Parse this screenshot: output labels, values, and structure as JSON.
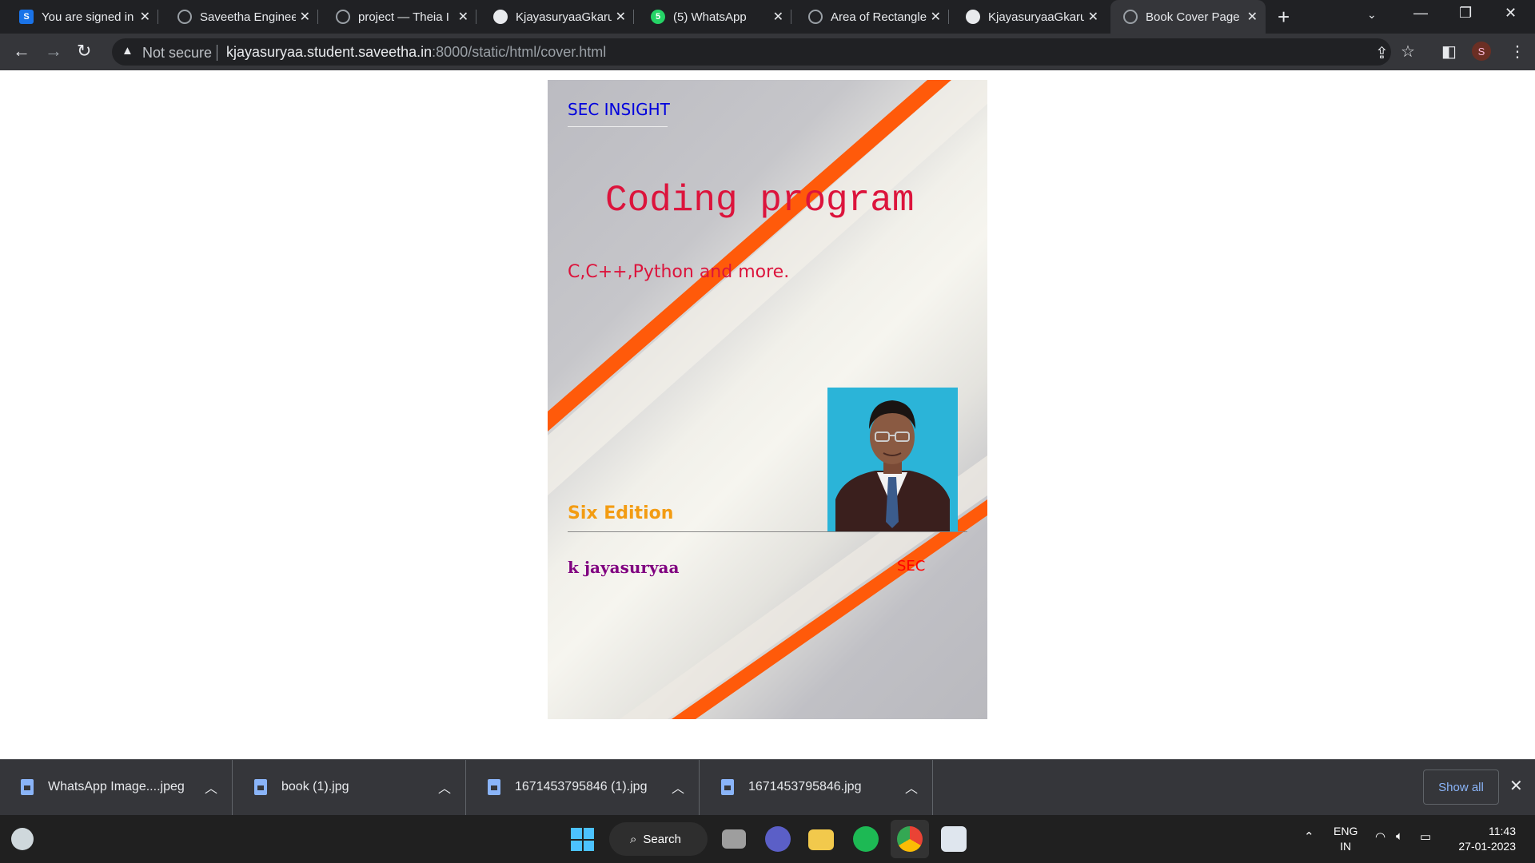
{
  "browser": {
    "tabs": [
      {
        "title": "You are signed in",
        "icon": "s-app-icon"
      },
      {
        "title": "Saveetha Enginee",
        "icon": "globe-icon"
      },
      {
        "title": "project — Theia I",
        "icon": "globe-icon"
      },
      {
        "title": "KjayasuryaaGkaru",
        "icon": "github-icon"
      },
      {
        "title": "(5) WhatsApp",
        "icon": "whatsapp-icon"
      },
      {
        "title": "Area of Rectangle",
        "icon": "globe-icon"
      },
      {
        "title": "KjayasuryaaGkaru",
        "icon": "github-icon"
      },
      {
        "title": "Book Cover Page",
        "icon": "globe-icon",
        "active": true
      }
    ],
    "address": {
      "security_label": "Not secure",
      "host": "kjayasuryaa.student.saveetha.in",
      "path": ":8000/static/html/cover.html"
    },
    "profile_initial": "S"
  },
  "cover": {
    "brand": "SEC INSIGHT",
    "title": "Coding program",
    "subtitle": "C,C++,Python and more.",
    "edition": "Six Edition",
    "author": "k jayasuryaa",
    "publisher": "SEC",
    "colors": {
      "brand": "#0000dd",
      "title": "#dc143c",
      "edition": "#f39c12",
      "author": "#800080",
      "stripe": "#ff5a0a"
    }
  },
  "downloads": {
    "items": [
      {
        "name": "WhatsApp Image....jpeg"
      },
      {
        "name": "book (1).jpg"
      },
      {
        "name": "1671453795846 (1).jpg"
      },
      {
        "name": "1671453795846.jpg"
      }
    ],
    "show_all": "Show all"
  },
  "taskbar": {
    "search_label": "Search",
    "lang_line1": "ENG",
    "lang_line2": "IN",
    "time": "11:43",
    "date": "27-01-2023"
  }
}
